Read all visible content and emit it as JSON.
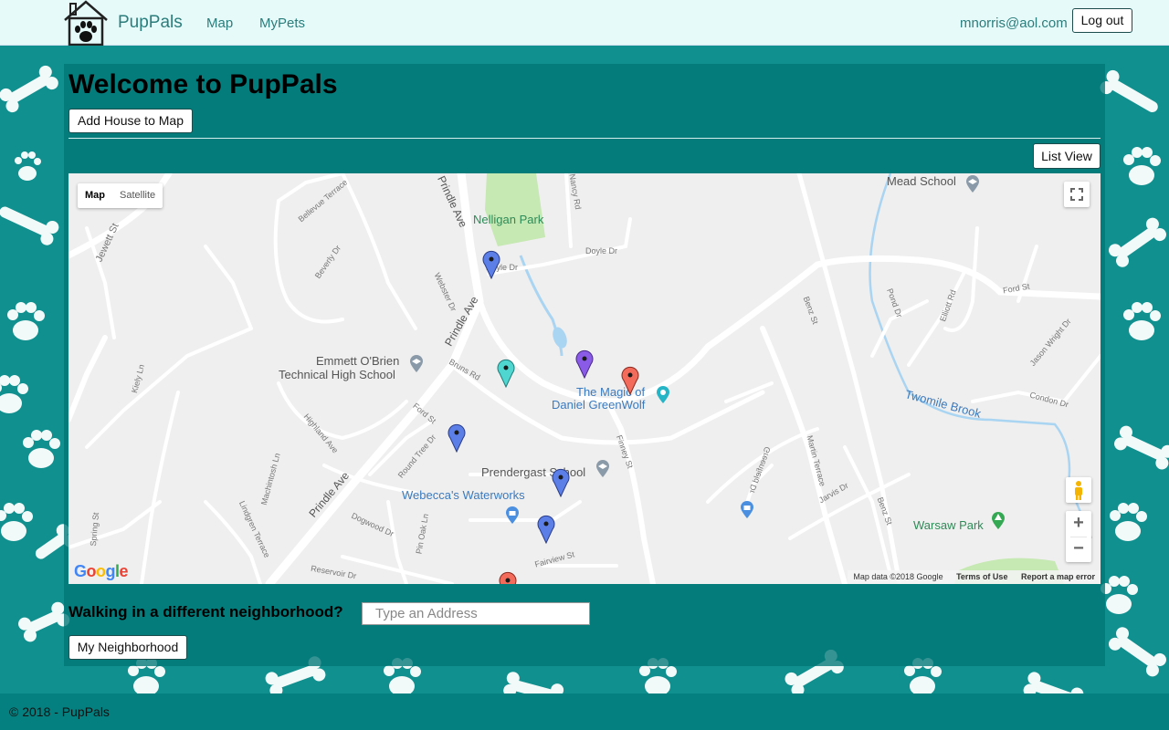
{
  "nav": {
    "brand": "PupPals",
    "links": [
      "Map",
      "MyPets"
    ],
    "user_email": "mnorris@aol.com",
    "logout_label": "Log out",
    "logo_icon": "house-paw-icon"
  },
  "main": {
    "title": "Welcome to PupPals",
    "add_house_label": "Add House to Map",
    "list_view_label": "List View"
  },
  "map": {
    "type_buttons": [
      "Map",
      "Satellite"
    ],
    "selected_type": "Map",
    "places": {
      "nelligan_park": "Nelligan Park",
      "mead_school": "Mead School",
      "emmett_1": "Emmett O'Brien",
      "emmett_2": "Technical High School",
      "magic_1": "The Magic of",
      "magic_2": "Daniel GreenWolf",
      "prendergast": "Prendergast School",
      "webecca": "Webecca's Waterworks",
      "warsaw": "Warsaw Park",
      "twomile": "Twomile Brook"
    },
    "streets": {
      "prindle_ave": "Prindle Ave",
      "doyle_dr": "Doyle Dr",
      "nancy_rd": "Nancy Rd",
      "jewett_st": "Jewett St",
      "bellevue": "Bellevue Terrace",
      "beverly": "Beverly Dr",
      "webster": "Webster Dr",
      "bruns": "Bruns Rd",
      "ford_st": "Ford St",
      "benz_st": "Benz St",
      "pond_dr": "Pond Dr",
      "elliott": "Elliott Rd",
      "jason": "Jason Wright Dr",
      "condon": "Condon Dr",
      "kiely": "Kiely Ln",
      "highland": "Highland Ave",
      "round_tree": "Round Tree Dr",
      "finney": "Finney St",
      "martin": "Martin Terrace",
      "jarvis": "Jarvis Dr",
      "machintosh": "Machintosh Ln",
      "lindgren": "Lindgren Terrace",
      "dogwood": "Dogwood Dr",
      "pin_oak": "Pin Oak Ln",
      "fairview": "Fairview St",
      "spring": "Spring St",
      "greenfield": "Greenfield Dr",
      "reservoir": "Reservoir Dr"
    },
    "footer": [
      "Map data ©2018 Google",
      "Terms of Use",
      "Report a map error"
    ],
    "google_logo": "Google",
    "zoom_in": "+",
    "zoom_out": "−",
    "pin_colors": {
      "blue": "#5b7fe6",
      "purple": "#8a5be6",
      "teal": "#4fd6d0",
      "red": "#f26b5b"
    }
  },
  "neighborhood": {
    "question": "Walking in a different neighborhood?",
    "address_placeholder": "Type an Address",
    "address_value": "",
    "my_neighborhood_label": "My Neighborhood"
  },
  "footer": {
    "copyright": "© 2018 - PupPals"
  },
  "colors": {
    "navbar_bg": "#e6fafa",
    "teal_bg": "#10908e",
    "panel_bg": "#007676",
    "brand_text": "#2a7d7b"
  }
}
